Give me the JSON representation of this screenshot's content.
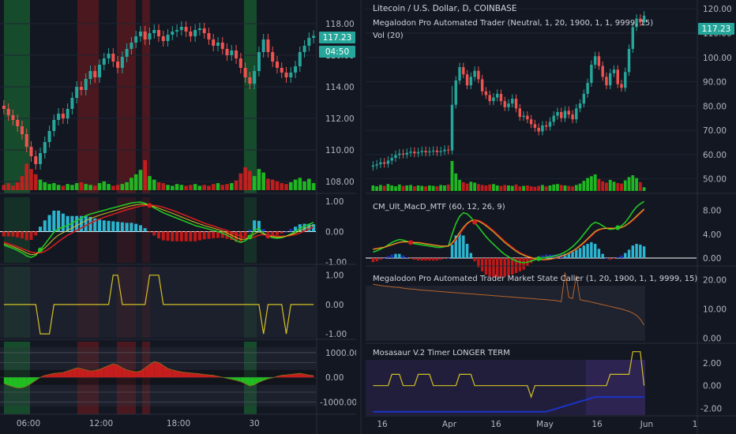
{
  "colors": {
    "background": "#131722",
    "grid": "#1f2433",
    "separator": "#2a2e39",
    "up": "#26a69a",
    "down": "#ef5350",
    "vol_up": "#22c622",
    "vol_down": "#d11e1e",
    "axis_text": "#b2b5be",
    "title_text": "#d1d4dc",
    "price_tag": "#26a69a",
    "macd_fast": "#22c622",
    "macd_slow": "#d11e1e",
    "signal_yellow": "#d4c024",
    "hist_blue": "#1c34c8",
    "hist_aqua": "#2bb5d0",
    "hist_red": "#c21818",
    "state_orange": "#b5652b",
    "bg_green": "#1a8f3a",
    "bg_red": "#8f1a1a",
    "bg_purple": "#3a2a6a",
    "bg_gray": "#2e3140"
  },
  "left": {
    "price_tag": "117.23",
    "countdown": "04:50",
    "time_labels": [
      "06:00",
      "12:00",
      "18:00",
      "30"
    ]
  },
  "right": {
    "title": "Litecoin / U.S. Dollar, D, COINBASE",
    "indicator_line": "Megalodon Pro Automated Trader (Neutral, 1, 20, 1900, 1, 1, 9999, 15)",
    "vol_label": "Vol (20)",
    "price_tag": "117.23",
    "macd_label": "CM_Ult_MacD_MTF (60, 12, 26, 9)",
    "state_label": "Megalodon Pro Automated Trader Market State Caller  (1, 20, 1900, 1, 1, 9999, 15)",
    "timer_label": "Mosasaur V.2 Timer LONGER TERM",
    "date_labels": [
      "16",
      "Apr",
      "16",
      "May",
      "16",
      "Jun",
      "1"
    ]
  },
  "chart_data": [
    {
      "type": "candlestick",
      "panel": "left-price",
      "ylim": [
        107.5,
        119.2
      ],
      "yticks": [
        108.0,
        110.0,
        112.0,
        114.0,
        116.0,
        118.0
      ],
      "close": [
        112.6,
        112.2,
        111.9,
        111.5,
        111.0,
        110.2,
        109.6,
        109.1,
        109.8,
        110.5,
        111.2,
        111.9,
        112.3,
        112.0,
        112.6,
        113.3,
        114.0,
        113.8,
        114.5,
        115.0,
        114.6,
        115.4,
        115.8,
        116.1,
        115.6,
        115.2,
        115.9,
        116.4,
        116.8,
        117.2,
        117.5,
        117.0,
        117.4,
        117.6,
        117.2,
        116.9,
        117.3,
        117.5,
        117.6,
        117.8,
        117.5,
        117.2,
        117.6,
        117.7,
        117.4,
        117.0,
        116.6,
        116.8,
        116.4,
        116.0,
        116.3,
        115.8,
        115.2,
        114.6,
        114.2,
        115.0,
        116.2,
        117.0,
        116.2,
        115.6,
        115.2,
        114.9,
        114.6,
        114.9,
        115.3,
        116.2,
        116.6,
        117.1,
        117.23
      ],
      "volume": [
        0.6,
        0.8,
        0.5,
        0.9,
        1.6,
        3.0,
        2.4,
        1.8,
        1.2,
        0.9,
        0.7,
        0.8,
        0.6,
        0.5,
        0.7,
        0.6,
        0.8,
        0.9,
        0.7,
        0.6,
        0.5,
        0.8,
        1.0,
        0.7,
        0.5,
        0.6,
        0.7,
        0.9,
        1.4,
        1.8,
        2.3,
        3.4,
        1.6,
        1.2,
        0.9,
        0.8,
        0.6,
        0.5,
        0.7,
        0.6,
        0.5,
        0.6,
        0.7,
        0.5,
        0.6,
        0.5,
        0.7,
        0.8,
        0.6,
        0.7,
        0.8,
        1.1,
        1.9,
        2.6,
        2.2,
        1.6,
        2.4,
        2.0,
        1.3,
        1.2,
        1.0,
        0.8,
        0.7,
        0.9,
        1.2,
        1.4,
        1.0,
        1.3,
        0.8
      ]
    },
    {
      "type": "macd",
      "panel": "left-macd",
      "ylim": [
        -1.0,
        1.05
      ],
      "yticks": [
        -1.0,
        0.0,
        1.0
      ],
      "fast": [
        -0.45,
        -0.5,
        -0.55,
        -0.62,
        -0.7,
        -0.8,
        -0.85,
        -0.78,
        -0.6,
        -0.42,
        -0.22,
        -0.02,
        0.1,
        0.15,
        0.2,
        0.28,
        0.36,
        0.44,
        0.52,
        0.58,
        0.62,
        0.66,
        0.7,
        0.74,
        0.78,
        0.82,
        0.86,
        0.9,
        0.94,
        0.96,
        0.97,
        0.93,
        0.86,
        0.78,
        0.7,
        0.62,
        0.56,
        0.5,
        0.44,
        0.38,
        0.32,
        0.26,
        0.2,
        0.16,
        0.12,
        0.08,
        0.04,
        0.0,
        -0.05,
        -0.12,
        -0.2,
        -0.3,
        -0.36,
        -0.3,
        -0.18,
        0.05,
        0.1,
        -0.05,
        -0.15,
        -0.2,
        -0.22,
        -0.2,
        -0.15,
        -0.08,
        0.0,
        0.1,
        0.18,
        0.24,
        0.3
      ],
      "slow": [
        -0.35,
        -0.4,
        -0.45,
        -0.5,
        -0.56,
        -0.62,
        -0.68,
        -0.7,
        -0.7,
        -0.65,
        -0.56,
        -0.45,
        -0.33,
        -0.22,
        -0.12,
        -0.04,
        0.04,
        0.12,
        0.2,
        0.28,
        0.35,
        0.41,
        0.47,
        0.52,
        0.57,
        0.62,
        0.67,
        0.72,
        0.76,
        0.8,
        0.84,
        0.86,
        0.87,
        0.86,
        0.84,
        0.8,
        0.75,
        0.7,
        0.64,
        0.58,
        0.52,
        0.46,
        0.4,
        0.34,
        0.28,
        0.23,
        0.18,
        0.13,
        0.08,
        0.03,
        -0.03,
        -0.09,
        -0.15,
        -0.2,
        -0.22,
        -0.18,
        -0.12,
        -0.1,
        -0.11,
        -0.13,
        -0.15,
        -0.16,
        -0.15,
        -0.13,
        -0.1,
        -0.05,
        0.02,
        0.08,
        0.15
      ]
    },
    {
      "type": "step",
      "panel": "left-signal",
      "ylim": [
        -1.05,
        1.1
      ],
      "yticks": [
        -1.0,
        0.0,
        1.0
      ],
      "values": [
        0,
        0,
        0,
        0,
        0,
        0,
        0,
        0,
        -1,
        -1,
        -1,
        0,
        0,
        0,
        0,
        0,
        0,
        0,
        0,
        0,
        0,
        0,
        0,
        0,
        1,
        1,
        0,
        0,
        0,
        0,
        0,
        0,
        1,
        1,
        1,
        0,
        0,
        0,
        0,
        0,
        0,
        0,
        0,
        0,
        0,
        0,
        0,
        0,
        0,
        0,
        0,
        0,
        0,
        0,
        0,
        0,
        0,
        -1,
        0,
        0,
        0,
        0,
        -1,
        0,
        0,
        0,
        0,
        0,
        0
      ]
    },
    {
      "type": "area",
      "panel": "left-timer",
      "ylim": [
        -1400,
        1350
      ],
      "yticks": [
        -1000.0,
        0.0,
        1000.0
      ],
      "values": [
        -250,
        -320,
        -380,
        -430,
        -420,
        -360,
        -250,
        -120,
        0,
        80,
        120,
        160,
        180,
        200,
        260,
        320,
        380,
        350,
        300,
        260,
        280,
        320,
        400,
        480,
        550,
        500,
        380,
        300,
        260,
        220,
        260,
        380,
        520,
        640,
        600,
        480,
        360,
        300,
        260,
        220,
        200,
        180,
        160,
        140,
        120,
        100,
        80,
        40,
        0,
        -40,
        -80,
        -120,
        -180,
        -260,
        -350,
        -300,
        -200,
        -120,
        -60,
        -20,
        40,
        80,
        100,
        120,
        140,
        160,
        130,
        90,
        70
      ]
    },
    {
      "type": "candlestick",
      "panel": "right-price",
      "ylim": [
        45,
        123
      ],
      "yticks": [
        50.0,
        60.0,
        70.0,
        80.0,
        90.0,
        100.0,
        110.0,
        120.0
      ],
      "close": [
        55.5,
        56.0,
        56.8,
        56.2,
        57.5,
        58.6,
        59.8,
        60.4,
        60.0,
        60.7,
        61.2,
        60.5,
        61.0,
        61.5,
        60.9,
        61.3,
        61.6,
        61.0,
        61.4,
        62.0,
        61.7,
        80.5,
        90.5,
        96.0,
        93.0,
        88.5,
        92.0,
        94.5,
        91.0,
        86.0,
        84.5,
        82.0,
        83.5,
        85.0,
        82.0,
        79.5,
        81.0,
        83.0,
        79.0,
        75.5,
        76.0,
        74.5,
        72.5,
        71.0,
        69.5,
        72.0,
        71.5,
        73.5,
        76.0,
        77.5,
        75.0,
        78.0,
        76.5,
        74.5,
        79.0,
        81.0,
        85.0,
        89.5,
        97.0,
        100.5,
        96.5,
        92.0,
        88.5,
        93.5,
        95.0,
        89.0,
        87.5,
        94.0,
        103.5,
        112.5,
        116.0,
        114.5,
        117.23
      ],
      "volume": [
        1.2,
        1.0,
        1.3,
        1.1,
        1.5,
        1.2,
        1.0,
        1.4,
        1.1,
        1.2,
        1.3,
        1.0,
        1.2,
        1.1,
        1.0,
        1.2,
        1.1,
        1.0,
        1.3,
        1.2,
        1.4,
        6.5,
        3.8,
        2.4,
        1.9,
        1.6,
        2.0,
        1.8,
        1.5,
        1.3,
        1.2,
        1.4,
        1.5,
        1.2,
        1.1,
        1.3,
        1.2,
        1.1,
        1.4,
        1.0,
        1.1,
        1.2,
        1.0,
        0.9,
        1.1,
        1.3,
        1.0,
        1.2,
        1.4,
        1.5,
        1.3,
        1.2,
        1.1,
        1.0,
        1.3,
        1.6,
        2.2,
        2.8,
        3.2,
        3.6,
        2.6,
        2.1,
        1.8,
        2.4,
        2.0,
        1.7,
        1.6,
        2.3,
        3.0,
        3.4,
        2.8,
        1.9,
        0.8
      ]
    },
    {
      "type": "macd",
      "panel": "right-macd",
      "ylim": [
        -1.2,
        10.2
      ],
      "yticks": [
        0.0,
        4.0,
        8.0
      ],
      "fast": [
        1.0,
        1.2,
        1.5,
        1.8,
        2.2,
        2.6,
        2.9,
        3.1,
        3.0,
        2.8,
        2.6,
        2.4,
        2.3,
        2.2,
        2.1,
        2.0,
        1.9,
        1.8,
        1.8,
        1.9,
        2.0,
        4.0,
        5.8,
        7.0,
        7.6,
        7.4,
        6.8,
        6.0,
        5.2,
        4.4,
        3.6,
        2.9,
        2.3,
        1.7,
        1.1,
        0.6,
        0.2,
        -0.2,
        -0.5,
        -0.7,
        -0.8,
        -0.7,
        -0.5,
        -0.3,
        -0.1,
        0.0,
        0.1,
        0.2,
        0.3,
        0.5,
        0.7,
        1.0,
        1.4,
        1.9,
        2.5,
        3.2,
        4.0,
        4.8,
        5.6,
        6.0,
        5.8,
        5.4,
        5.0,
        4.8,
        4.9,
        5.1,
        5.4,
        6.0,
        6.8,
        7.8,
        8.6,
        9.1,
        9.5
      ],
      "slow": [
        1.5,
        1.6,
        1.7,
        1.8,
        2.0,
        2.2,
        2.4,
        2.6,
        2.7,
        2.7,
        2.7,
        2.6,
        2.6,
        2.5,
        2.4,
        2.3,
        2.2,
        2.1,
        2.0,
        2.0,
        2.0,
        2.4,
        3.1,
        4.0,
        4.9,
        5.7,
        6.2,
        6.4,
        6.3,
        6.0,
        5.6,
        5.1,
        4.6,
        4.0,
        3.4,
        2.8,
        2.3,
        1.8,
        1.3,
        0.9,
        0.6,
        0.3,
        0.1,
        -0.1,
        -0.2,
        -0.3,
        -0.3,
        -0.2,
        -0.1,
        0.1,
        0.3,
        0.5,
        0.8,
        1.1,
        1.5,
        2.0,
        2.5,
        3.1,
        3.7,
        4.3,
        4.7,
        4.9,
        5.0,
        5.0,
        5.0,
        5.0,
        5.1,
        5.4,
        5.8,
        6.3,
        6.9,
        7.5,
        8.1
      ]
    },
    {
      "type": "line",
      "panel": "right-state",
      "ylim": [
        -1.5,
        24
      ],
      "yticks": [
        0.0,
        10.0,
        20.0
      ],
      "values": [
        18.5,
        18.3,
        18.1,
        17.9,
        17.8,
        17.6,
        17.5,
        17.4,
        17.2,
        17.0,
        16.9,
        16.8,
        16.6,
        16.5,
        16.4,
        16.3,
        16.2,
        16.1,
        16.0,
        15.9,
        15.8,
        15.7,
        15.6,
        15.5,
        15.4,
        15.3,
        15.2,
        15.1,
        15.0,
        14.9,
        14.8,
        14.7,
        14.6,
        14.5,
        14.4,
        14.3,
        14.2,
        14.1,
        14.0,
        13.9,
        13.8,
        13.7,
        13.6,
        13.5,
        13.4,
        13.3,
        13.2,
        13.1,
        13.0,
        12.8,
        12.5,
        22.5,
        14.0,
        13.6,
        21.5,
        13.2,
        12.9,
        12.7,
        12.4,
        12.1,
        11.8,
        11.5,
        11.2,
        10.9,
        10.6,
        10.3,
        10.0,
        9.6,
        9.2,
        8.6,
        7.8,
        6.5,
        4.5
      ]
    },
    {
      "type": "step",
      "panel": "right-timer",
      "ylim": [
        -2.6,
        3.4
      ],
      "yticks": [
        -2.0,
        0.0,
        2.0
      ],
      "values": [
        0,
        0,
        0,
        0,
        0,
        1,
        1,
        1,
        0,
        0,
        0,
        0,
        1,
        1,
        1,
        1,
        0,
        0,
        0,
        0,
        0,
        0,
        0,
        1,
        1,
        1,
        1,
        0,
        0,
        0,
        0,
        0,
        0,
        0,
        0,
        0,
        0,
        0,
        0,
        0,
        0,
        0,
        -1,
        0,
        0,
        0,
        0,
        0,
        0,
        0,
        0,
        0,
        0,
        0,
        0,
        0,
        0,
        0,
        0,
        0,
        0,
        0,
        0,
        1,
        1,
        1,
        1,
        1,
        1,
        3,
        3,
        3,
        0
      ],
      "baseline": [
        -2.3,
        -2.3,
        -2.3,
        -2.3,
        -2.3,
        -2.3,
        -2.3,
        -2.3,
        -2.3,
        -2.3,
        -2.3,
        -2.3,
        -2.3,
        -2.3,
        -2.3,
        -2.3,
        -2.3,
        -2.3,
        -2.3,
        -2.3,
        -2.3,
        -2.3,
        -2.3,
        -2.3,
        -2.3,
        -2.3,
        -2.3,
        -2.3,
        -2.3,
        -2.3,
        -2.3,
        -2.3,
        -2.3,
        -2.3,
        -2.3,
        -2.3,
        -2.3,
        -2.3,
        -2.3,
        -2.3,
        -2.3,
        -2.3,
        -2.3,
        -2.3,
        -2.3,
        -2.3,
        -2.3,
        -2.2,
        -2.1,
        -2.0,
        -1.9,
        -1.8,
        -1.7,
        -1.6,
        -1.5,
        -1.4,
        -1.3,
        -1.2,
        -1.1,
        -1.0,
        -1.0,
        -1.0,
        -1.0,
        -1.0,
        -1.0,
        -1.0,
        -1.0,
        -1.0,
        -1.0,
        -1.0,
        -1.0,
        -1.0,
        -1.0
      ]
    }
  ]
}
